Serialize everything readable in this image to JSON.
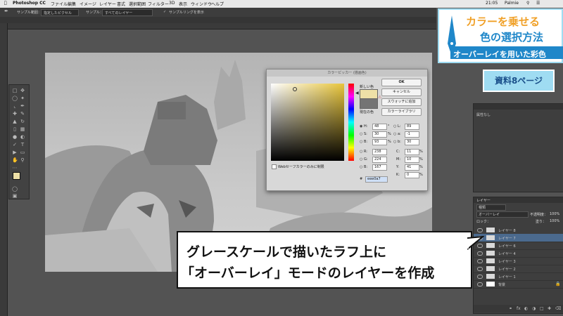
{
  "menubar": {
    "app": "Photoshop CC",
    "items": [
      "ファイル",
      "編集",
      "イメージ",
      "レイヤー",
      "書式",
      "選択範囲",
      "フィルター",
      "3D",
      "表示",
      "ウィンドウ",
      "ヘルプ"
    ],
    "clock": "21:05",
    "user": "Palmie"
  },
  "options": {
    "sample_size_label": "サンプル範囲：",
    "sample_size_value": "指定したピクセル",
    "sample_label": "サンプル：",
    "sample_value": "すべてのレイヤー",
    "ring_label": "サンプルリングを表示"
  },
  "title_card": {
    "line1": "カラーを乗せる",
    "line2": "色の選択方法",
    "line3": "オーバーレイを用いた彩色"
  },
  "ref_badge": "資料8ページ",
  "picker": {
    "title": "カラーピッカー (描画色)",
    "new_label": "新しい色",
    "current_label": "現在の色",
    "ok": "OK",
    "cancel": "キャンセル",
    "add_swatch": "スウォッチに追加",
    "library": "カラーライブラリ",
    "web_only": "Webセーフカラーのみに制限",
    "new_color": "#eee0a7",
    "current_color": "#747474",
    "hex": "eee0a7",
    "H": "48",
    "S": "30",
    "B": "93",
    "R": "238",
    "G": "224",
    "Bv": "167",
    "L": "89",
    "a": "-1",
    "b": "30",
    "C": "11",
    "M": "10",
    "Y": "41",
    "K": "0",
    "deg": "°",
    "pct": "%"
  },
  "props_panel": {
    "text": "属性なし"
  },
  "layers_panel": {
    "tab": "レイヤー",
    "kind": "種類",
    "blend_mode": "オーバーレイ",
    "opacity_label": "不透明度：",
    "opacity": "100%",
    "lock_label": "ロック：",
    "fill_label": "塗り：",
    "fill": "100%",
    "layers": [
      "レイヤー 8",
      "レイヤー 7",
      "レイヤー 6",
      "レイヤー 4",
      "レイヤー 3",
      "レイヤー 2",
      "レイヤー 1",
      "背景"
    ],
    "selected_index": 1
  },
  "caption": {
    "line1": "グレースケールで描いたラフ上に",
    "line2": "「オーバーレイ」モードのレイヤーを作成"
  },
  "colors": {
    "title_blue": "#1f87c9",
    "title_orange": "#f0a027",
    "card_bg": "#9fdcf2"
  }
}
